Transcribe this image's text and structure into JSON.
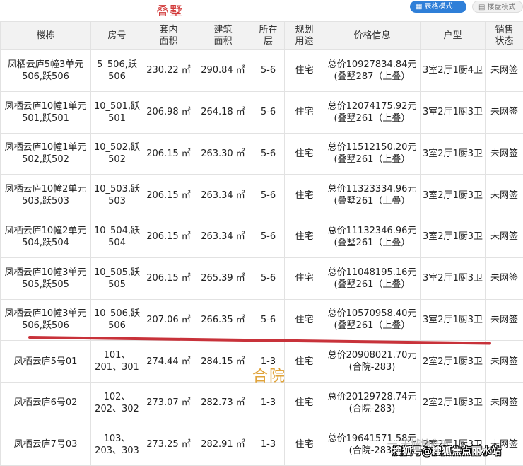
{
  "annotations": {
    "top": "叠墅",
    "middle": "合院",
    "watermark": "一 天城地产五",
    "corner_tag": "搜狐号@搜狐焦点丽水站"
  },
  "mode_buttons": {
    "table": "表格模式",
    "disk": "楼盘模式"
  },
  "icons": {
    "table": "grid-icon",
    "disk": "building-icon"
  },
  "colors": {
    "header_bg": "#f2f2f2",
    "accent_blue": "#2f7fd8",
    "annotation_red": "#d23a3a",
    "annotation_gold": "#e0a33a"
  },
  "table": {
    "headers": [
      "楼栋",
      "房号",
      "套内\n面积",
      "建筑\n面积",
      "所在\n层",
      "规划\n用途",
      "价格信息",
      "户型",
      "销售\n状态"
    ],
    "rows": [
      {
        "building": "凤栖云庐5幢3单元506,跃506",
        "room": "5_506,跃506",
        "inner": "230.22 ㎡",
        "gross": "290.84 ㎡",
        "floor": "5-6",
        "use": "住宅",
        "price": "总价10927834.84元(叠墅287（上叠）",
        "type": "3室2厅1厨4卫",
        "status": "未网签"
      },
      {
        "building": "凤栖云庐10幢1单元501,跃501",
        "room": "10_501,跃501",
        "inner": "206.98 ㎡",
        "gross": "264.18 ㎡",
        "floor": "5-6",
        "use": "住宅",
        "price": "总价12074175.92元(叠墅261（上叠）",
        "type": "3室2厅1厨3卫",
        "status": "未网签"
      },
      {
        "building": "凤栖云庐10幢1单元502,跃502",
        "room": "10_502,跃502",
        "inner": "206.15 ㎡",
        "gross": "263.30 ㎡",
        "floor": "5-6",
        "use": "住宅",
        "price": "总价11512150.20元(叠墅261（上叠）",
        "type": "3室2厅1厨3卫",
        "status": "未网签"
      },
      {
        "building": "凤栖云庐10幢2单元503,跃503",
        "room": "10_503,跃503",
        "inner": "206.15 ㎡",
        "gross": "263.34 ㎡",
        "floor": "5-6",
        "use": "住宅",
        "price": "总价11323334.96元(叠墅261（上叠）",
        "type": "3室2厅1厨3卫",
        "status": "未网签"
      },
      {
        "building": "凤栖云庐10幢2单元504,跃504",
        "room": "10_504,跃504",
        "inner": "206.15 ㎡",
        "gross": "263.34 ㎡",
        "floor": "5-6",
        "use": "住宅",
        "price": "总价11132346.96元(叠墅261（上叠）",
        "type": "3室2厅1厨3卫",
        "status": "未网签"
      },
      {
        "building": "凤栖云庐10幢3单元505,跃505",
        "room": "10_505,跃505",
        "inner": "206.15 ㎡",
        "gross": "265.39 ㎡",
        "floor": "5-6",
        "use": "住宅",
        "price": "总价11048195.16元(叠墅261（上叠）",
        "type": "3室2厅1厨3卫",
        "status": "未网签"
      },
      {
        "building": "凤栖云庐10幢3单元506,跃506",
        "room": "10_506,跃506",
        "inner": "207.06 ㎡",
        "gross": "266.35 ㎡",
        "floor": "5-6",
        "use": "住宅",
        "price": "总价10570958.40元(叠墅261（上叠）",
        "type": "3室2厅1厨3卫",
        "status": "未网签"
      },
      {
        "building": "凤栖云庐5号01",
        "room": "101、201、301",
        "inner": "274.44 ㎡",
        "gross": "284.15 ㎡",
        "floor": "1-3",
        "use": "住宅",
        "price": "总价20908021.70元(合院-283)",
        "type": "2室2厅1厨3卫",
        "status": "未网签"
      },
      {
        "building": "凤栖云庐6号02",
        "room": "102、202、302",
        "inner": "273.07 ㎡",
        "gross": "282.73 ㎡",
        "floor": "1-3",
        "use": "住宅",
        "price": "总价20129728.74元(合院-283)",
        "type": "2室2厅1厨3卫",
        "status": "未网签"
      },
      {
        "building": "凤栖云庐7号03",
        "room": "103、203、303",
        "inner": "273.25 ㎡",
        "gross": "282.91 ㎡",
        "floor": "1-3",
        "use": "住宅",
        "price": "总价19641571.58元(合院-283)",
        "type": "2室2厅1厨3卫",
        "status": "未网签"
      }
    ]
  }
}
